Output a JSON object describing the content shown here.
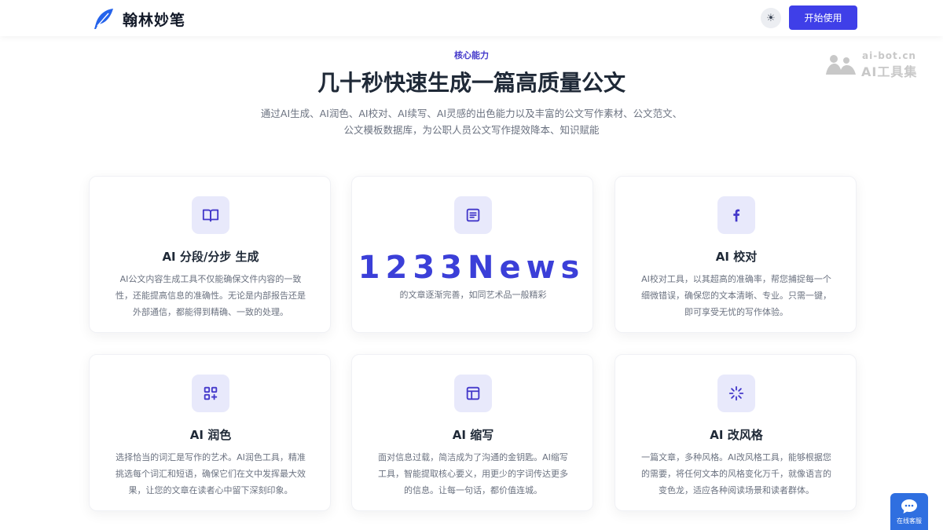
{
  "header": {
    "brand": "翰林妙笔",
    "theme_toggle_glyph": "☀",
    "cta_label": "开始使用"
  },
  "watermark": {
    "url": "ai-bot.cn",
    "name": "AI工具集"
  },
  "hero": {
    "eyebrow": "核心能力",
    "title": "几十秒快速生成一篇高质量公文",
    "description_line1": "通过AI生成、AI润色、AI校对、AI续写、AI灵感的出色能力以及丰富的公文写作素材、公文范文、",
    "description_line2": "公文模板数据库，为公职人员公文写作提效降本、知识赋能"
  },
  "features": [
    {
      "icon": "book-open-icon",
      "title": "AI 分段/分步 生成",
      "description": "AI公文内容生成工具不仅能确保文件内容的一致性，还能提高信息的准确性。无论是内部报告还是外部通信，都能得到精确、一致的处理。"
    },
    {
      "icon": "document-lines-icon",
      "title": "",
      "description": "的文章逐渐完善，如同艺术品一般精彩"
    },
    {
      "icon": "facebook-f-icon",
      "title": "AI 校对",
      "description": "AI校对工具，以其超高的准确率，帮您捕捉每一个细微错误，确保您的文本清晰、专业。只需一键，即可享受无忧的写作体验。"
    },
    {
      "icon": "grid-plus-icon",
      "title": "AI 润色",
      "description": "选择恰当的词汇是写作的艺术。AI润色工具，精准挑选每个词汇和短语，确保它们在文中发挥最大效果，让您的文章在读者心中留下深刻印象。"
    },
    {
      "icon": "layout-panel-icon",
      "title": "AI 缩写",
      "description": "面对信息过载，简洁成为了沟通的金钥匙。AI缩写工具，智能提取核心要义，用更少的字词传达更多的信息。让每一句话，都价值连城。"
    },
    {
      "icon": "loader-spinner-icon",
      "title": "AI 改风格",
      "description": "一篇文章，多种风格。AI改风格工具，能够根据您的需要，将任何文本的风格变化万千，就像语言的变色龙，适应各种阅读场景和读者群体。"
    }
  ],
  "overlay": {
    "text": "1233News"
  },
  "chat": {
    "label": "在线客服"
  },
  "colors": {
    "accent": "#3f3fe8",
    "icon_bg": "#e8e9fb",
    "icon_fg": "#4338ca",
    "chat_bg": "#2f6fe0"
  }
}
